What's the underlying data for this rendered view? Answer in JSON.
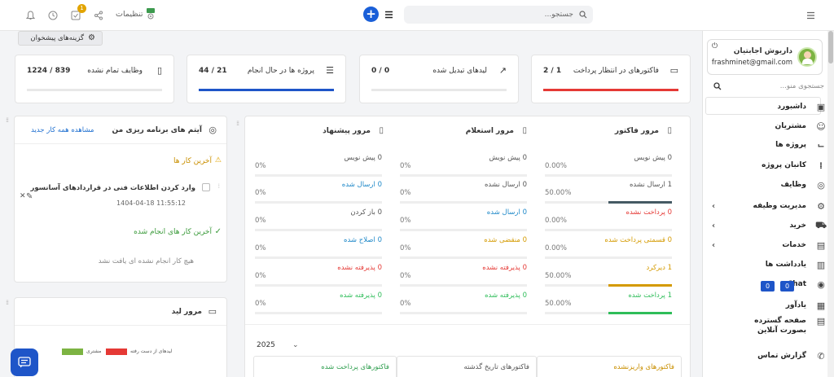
{
  "topbar": {
    "search_placeholder": "جستجو...",
    "settings_label": "تنظیمات",
    "task_badge": "1"
  },
  "suggest_button": "گزینه‌های پیشخوان",
  "stats": [
    {
      "title": "فاکتورهای در انتظار پرداخت",
      "value": "2 / 1",
      "progress": 1.0,
      "color": "#e53935"
    },
    {
      "title": "لیدهای تبدیل شده",
      "value": "0 / 0",
      "progress": 0.0,
      "color": "#e8e8e8"
    },
    {
      "title": "پروژه ها در حال انجام",
      "value": "44 / 21",
      "progress": 1.0,
      "color": "#1e55c8"
    },
    {
      "title": "وظایف تمام نشده",
      "value": "1224 / 839",
      "progress": 0.0,
      "color": "#e8e8e8"
    }
  ],
  "todo": {
    "title": "آیتم های برنامه ریزی من",
    "new_link": "مشاهده همه کار جدید",
    "recent_title": "آخرین کار ها",
    "item_text": "وارد کردن اطلاعات فنی در قراردادهای آسانسور",
    "item_time": "1404-04-18 11:55:12",
    "done_title": "آخرین کار های انجام شده",
    "empty_text": "هیچ کار انجام نشده ای یافت نشد"
  },
  "lead_review": {
    "title": "مرور لید",
    "legend": [
      "لیدهای از دست رفته",
      "مشتری"
    ],
    "legend_colors": [
      "#e53935",
      "#7cb342"
    ]
  },
  "overview": {
    "columns": [
      {
        "title": "مرور فاکتور",
        "rows": [
          {
            "label": "0 پیش نویس",
            "pct": "0.00%",
            "fill": 0.0,
            "color": "#555",
            "label_color": "#555"
          },
          {
            "label": "1 ارسال نشده",
            "pct": "50.00%",
            "fill": 0.5,
            "color": "#455a64",
            "label_color": "#555"
          },
          {
            "label": "0 پرداخت نشده",
            "pct": "0.00%",
            "fill": 0.0,
            "color": "#e53935",
            "label_color": "#e53935"
          },
          {
            "label": "0 قسمتی پرداخت شده",
            "pct": "0.00%",
            "fill": 0.0,
            "color": "#d49a00",
            "label_color": "#d49a00"
          },
          {
            "label": "1 دیرکرد",
            "pct": "50.00%",
            "fill": 0.5,
            "color": "#d49a00",
            "label_color": "#d49a00"
          },
          {
            "label": "1 پرداخت شده",
            "pct": "50.00%",
            "fill": 0.5,
            "color": "#2ebd59",
            "label_color": "#2ebd59"
          }
        ]
      },
      {
        "title": "مرور استعلام",
        "rows": [
          {
            "label": "0 پیش نویش",
            "pct": "0%",
            "fill": 0.0,
            "color": "#555",
            "label_color": "#555"
          },
          {
            "label": "0 ارسال نشده",
            "pct": "0%",
            "fill": 0.0,
            "color": "#555",
            "label_color": "#555"
          },
          {
            "label": "0 ارسال شده",
            "pct": "0%",
            "fill": 0.0,
            "color": "#1e88c8",
            "label_color": "#1e88c8"
          },
          {
            "label": "0 منقضی شده",
            "pct": "0%",
            "fill": 0.0,
            "color": "#d49a00",
            "label_color": "#d49a00"
          },
          {
            "label": "0 پذیرفته نشده",
            "pct": "0%",
            "fill": 0.0,
            "color": "#e53935",
            "label_color": "#e53935"
          },
          {
            "label": "0 پذیرفته شده",
            "pct": "0%",
            "fill": 0.0,
            "color": "#2ebd59",
            "label_color": "#2ebd59"
          }
        ]
      },
      {
        "title": "مرور پیشنهاد",
        "rows": [
          {
            "label": "0 پیش نویس",
            "pct": "0%",
            "fill": 0.0,
            "color": "#555",
            "label_color": "#555"
          },
          {
            "label": "0 ارسال شده",
            "pct": "0%",
            "fill": 0.0,
            "color": "#1e88c8",
            "label_color": "#1e88c8"
          },
          {
            "label": "0 باز کردن",
            "pct": "0%",
            "fill": 0.0,
            "color": "#555",
            "label_color": "#555"
          },
          {
            "label": "0 اصلاح شده",
            "pct": "0%",
            "fill": 0.0,
            "color": "#1e88c8",
            "label_color": "#1e88c8"
          },
          {
            "label": "0 پذیرفته نشده",
            "pct": "0%",
            "fill": 0.0,
            "color": "#e53935",
            "label_color": "#e53935"
          },
          {
            "label": "0 پذیرفته شده",
            "pct": "0%",
            "fill": 0.0,
            "color": "#2ebd59",
            "label_color": "#2ebd59"
          }
        ]
      }
    ],
    "year": "2025",
    "bottom_tabs": [
      "فاکتورهای واریزنشده",
      "فاکتورهای تاریخ گذشته",
      "فاکتورهای پرداخت شده"
    ]
  },
  "sidebar": {
    "user_name": "داریوش اجابتیان",
    "user_email": "frashminet@gmail.com",
    "search_placeholder": "جستجوی منو...",
    "items": [
      {
        "label": "داشبورد",
        "icon": "dashboard-icon",
        "glyph": "▣",
        "chevron": false
      },
      {
        "label": "مشتریان",
        "icon": "user-icon",
        "glyph": "☺",
        "chevron": false
      },
      {
        "label": "پروژه ها",
        "icon": "chart-icon",
        "glyph": "⌙",
        "chevron": false
      },
      {
        "label": "کانبان پروژه",
        "icon": "kanban-icon",
        "glyph": "⁞",
        "chevron": false
      },
      {
        "label": "وظایف",
        "icon": "check-circle-icon",
        "glyph": "◎",
        "chevron": false
      },
      {
        "label": "مدیریت وظیفه",
        "icon": "gears-icon",
        "glyph": "⚙",
        "chevron": true
      },
      {
        "label": "خرید",
        "icon": "cart-icon",
        "glyph": "⛟",
        "chevron": true
      },
      {
        "label": "خدمات",
        "icon": "services-icon",
        "glyph": "▤",
        "chevron": true
      },
      {
        "label": "یادداشت ها",
        "icon": "note-icon",
        "glyph": "▥",
        "chevron": false
      },
      {
        "label": "Chat",
        "icon": "chat-icon",
        "glyph": "◉",
        "chevron": false
      },
      {
        "label": "یادآور",
        "icon": "calendar-icon",
        "glyph": "▦",
        "chevron": false
      },
      {
        "label": "صفحه گسترده بصورت آنلاین",
        "icon": "spreadsheet-icon",
        "glyph": "▤",
        "chevron": false
      },
      {
        "label": "گزارش تماس",
        "icon": "phone-icon",
        "glyph": "✆",
        "chevron": false
      }
    ],
    "chat_counts": [
      "0",
      "0"
    ]
  }
}
